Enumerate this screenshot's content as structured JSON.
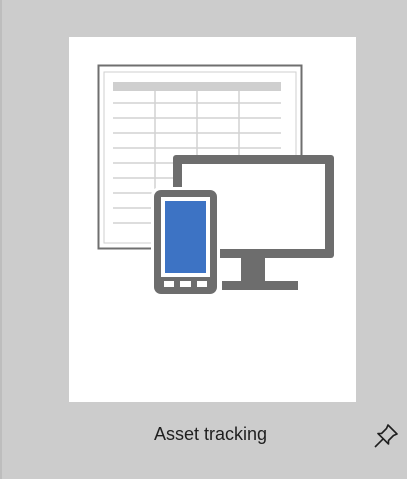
{
  "template": {
    "label": "Asset tracking"
  },
  "icons": {
    "thumbnail": "asset-tracking-illustration",
    "pin": "pin-icon"
  },
  "colors": {
    "tile_background": "#cccccc",
    "thumbnail_background": "#ffffff",
    "illustration_gray": "#6d6d6d",
    "phone_screen_blue": "#3d73c4"
  }
}
